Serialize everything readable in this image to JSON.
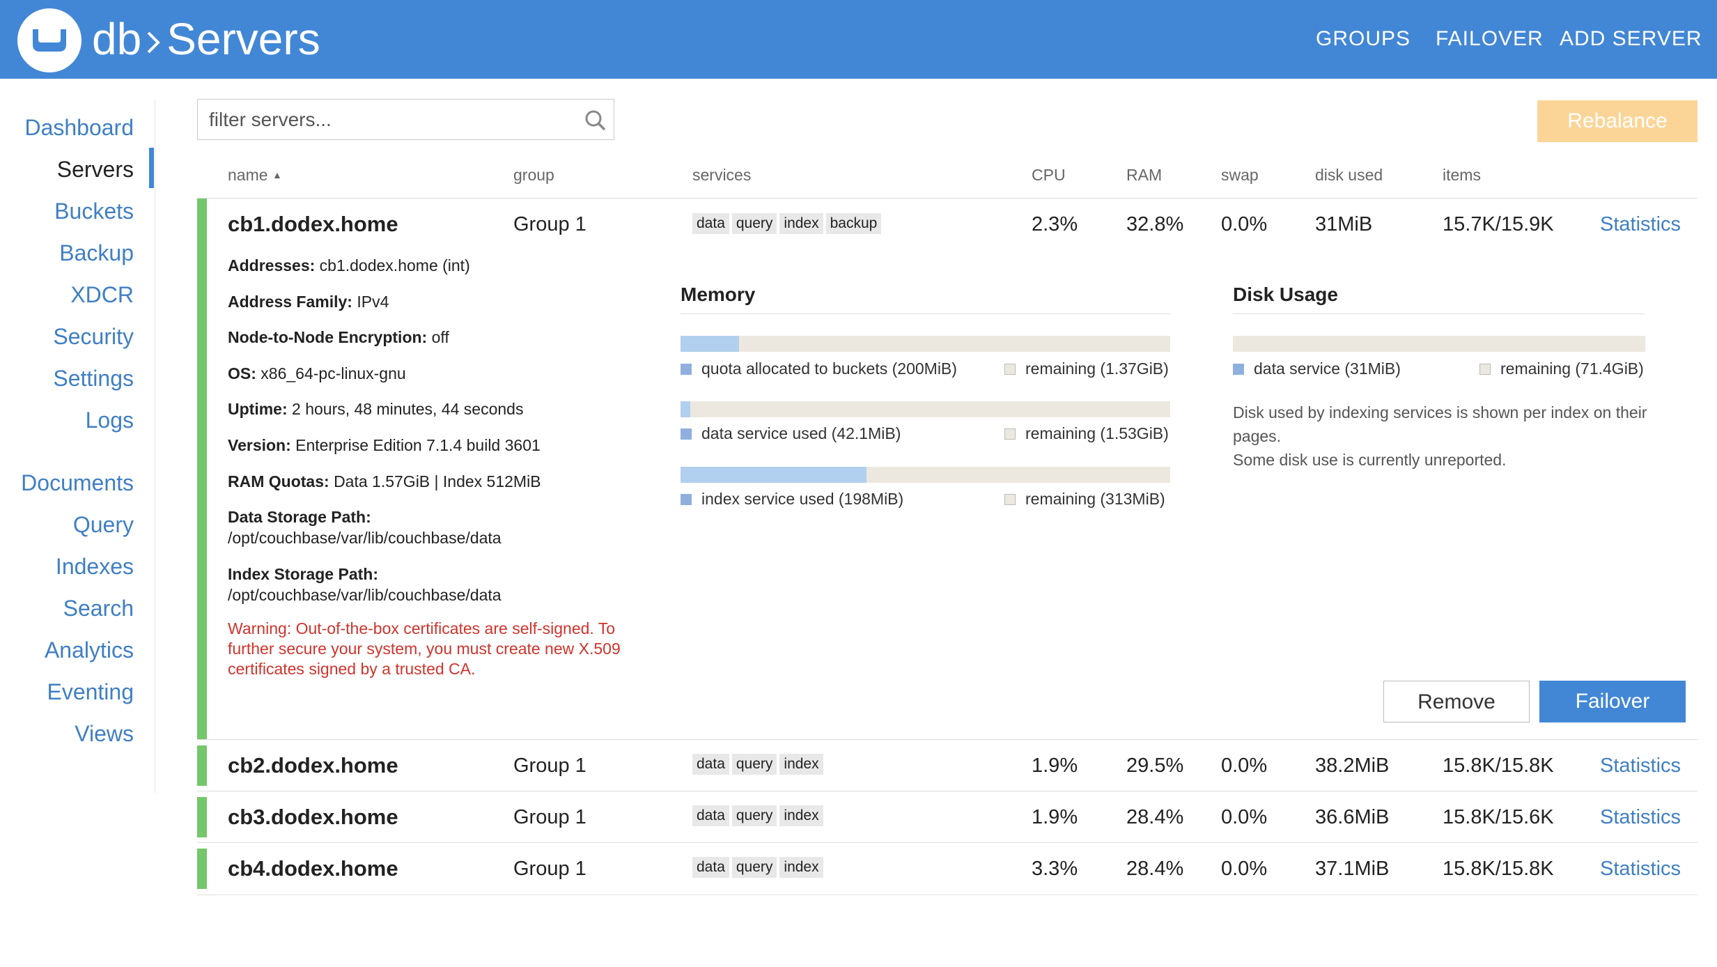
{
  "header": {
    "app": "db",
    "page": "Servers",
    "nav": [
      "GROUPS",
      "FAILOVER",
      "ADD SERVER"
    ],
    "brand_color": "#4287d6"
  },
  "sidebar": {
    "items": [
      "Dashboard",
      "Servers",
      "Buckets",
      "Backup",
      "XDCR",
      "Security",
      "Settings",
      "Logs",
      "Documents",
      "Query",
      "Indexes",
      "Search",
      "Analytics",
      "Eventing",
      "Views"
    ],
    "active": "Servers"
  },
  "toolbar": {
    "filter_placeholder": "filter servers...",
    "rebalance_label": "Rebalance",
    "icons": [
      "search-icon"
    ]
  },
  "table": {
    "columns": [
      "name",
      "group",
      "services",
      "CPU",
      "RAM",
      "swap",
      "disk used",
      "items"
    ],
    "sort_column": "name",
    "sort_dir": "ascending",
    "link_label": "Statistics",
    "rows": [
      {
        "name": "cb1.dodex.home",
        "group": "Group 1",
        "services": [
          "data",
          "query",
          "index",
          "backup"
        ],
        "cpu": "2.3%",
        "ram": "32.8%",
        "swap": "0.0%",
        "disk": "31MiB",
        "items": "15.7K/15.9K",
        "expanded": true
      },
      {
        "name": "cb2.dodex.home",
        "group": "Group 1",
        "services": [
          "data",
          "query",
          "index"
        ],
        "cpu": "1.9%",
        "ram": "29.5%",
        "swap": "0.0%",
        "disk": "38.2MiB",
        "items": "15.8K/15.8K",
        "expanded": false
      },
      {
        "name": "cb3.dodex.home",
        "group": "Group 1",
        "services": [
          "data",
          "query",
          "index"
        ],
        "cpu": "1.9%",
        "ram": "28.4%",
        "swap": "0.0%",
        "disk": "36.6MiB",
        "items": "15.8K/15.6K",
        "expanded": false
      },
      {
        "name": "cb4.dodex.home",
        "group": "Group 1",
        "services": [
          "data",
          "query",
          "index"
        ],
        "cpu": "3.3%",
        "ram": "28.4%",
        "swap": "0.0%",
        "disk": "37.1MiB",
        "items": "15.8K/15.8K",
        "expanded": false
      }
    ]
  },
  "details": {
    "fields": [
      {
        "label": "Addresses:",
        "value": "cb1.dodex.home (int)"
      },
      {
        "label": "Address Family:",
        "value": "IPv4"
      },
      {
        "label": "Node-to-Node Encryption:",
        "value": "off"
      },
      {
        "label": "OS:",
        "value": "x86_64-pc-linux-gnu"
      },
      {
        "label": "Uptime:",
        "value": "2 hours, 48 minutes, 44 seconds"
      },
      {
        "label": "Version:",
        "value": "Enterprise Edition 7.1.4 build 3601"
      },
      {
        "label": "RAM Quotas:",
        "value": "Data 1.57GiB | Index 512MiB"
      }
    ],
    "paths": [
      {
        "label": "Data Storage Path:",
        "value": "/opt/couchbase/var/lib/couchbase/data"
      },
      {
        "label": "Index Storage Path:",
        "value": "/opt/couchbase/var/lib/couchbase/data"
      }
    ],
    "warning": "Warning: Out-of-the-box certificates are self-signed. To further secure your system, you must create new X.509 certificates signed by a trusted CA.",
    "warning_color": "#d0342c"
  },
  "memory": {
    "title": "Memory",
    "bars": [
      {
        "fill": 0.12,
        "used_label": "quota allocated to buckets (200MiB)",
        "remaining_label": "remaining (1.37GiB)"
      },
      {
        "fill": 0.02,
        "used_label": "data service used (42.1MiB)",
        "remaining_label": "remaining (1.53GiB)"
      },
      {
        "fill": 0.38,
        "used_label": "index service used (198MiB)",
        "remaining_label": "remaining (313MiB)"
      }
    ]
  },
  "disk": {
    "title": "Disk Usage",
    "bar": {
      "fill": 0.0,
      "used_label": "data service (31MiB)",
      "remaining_label": "remaining (71.4GiB)"
    },
    "note1": "Disk used by indexing services is shown per index on their pages.",
    "note2": "Some disk use is currently unreported."
  },
  "actions": {
    "remove": "Remove",
    "failover": "Failover"
  }
}
